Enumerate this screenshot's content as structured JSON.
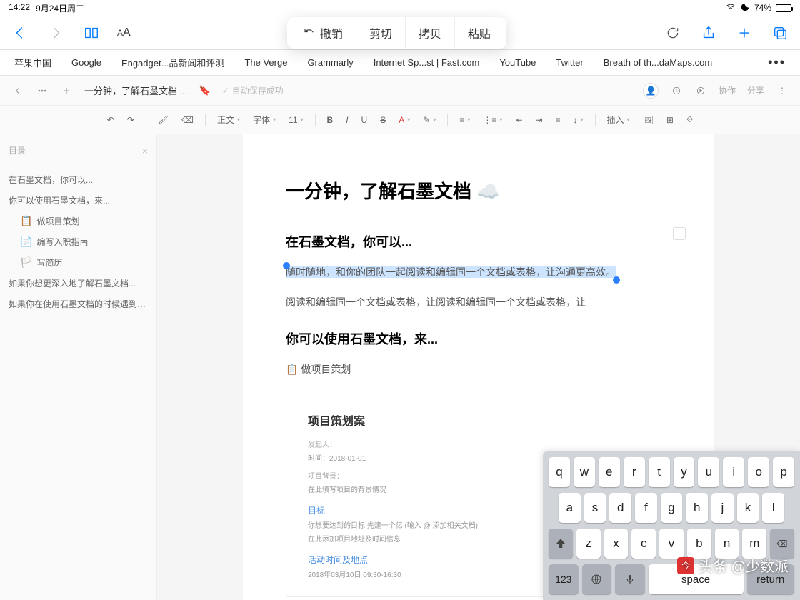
{
  "status": {
    "time": "14:22",
    "date": "9月24日周二",
    "battery": "74%"
  },
  "safari": {
    "callout": {
      "undo": "撤销",
      "cut": "剪切",
      "copy": "拷贝",
      "paste": "粘贴"
    }
  },
  "favorites": [
    "苹果中国",
    "Google",
    "Engadget...品新闻和评测",
    "The Verge",
    "Grammarly",
    "Internet Sp...st | Fast.com",
    "YouTube",
    "Twitter",
    "Breath of th...daMaps.com"
  ],
  "appHeader": {
    "title": "一分钟，了解石墨文档 ...",
    "autosave": "自动保存成功",
    "actions": {
      "coop": "协作",
      "share": "分享"
    }
  },
  "toolbar": {
    "normal": "正文",
    "font": "字体",
    "size": "11",
    "insert": "插入"
  },
  "sidebar": {
    "title": "目录",
    "items": [
      "在石墨文档，你可以...",
      "你可以使用石墨文档，来...",
      "如果你想更深入地了解石墨文档...",
      "如果你在使用石墨文档的时候遇到问题..."
    ],
    "subs": [
      {
        "emoji": "📋",
        "label": "做项目策划"
      },
      {
        "emoji": "📄",
        "label": "编写入职指南"
      },
      {
        "emoji": "🏳️",
        "label": "写简历"
      }
    ]
  },
  "doc": {
    "title": "一分钟，了解石墨文档 ☁️",
    "h2_1": "在石墨文档，你可以...",
    "selected": "随时随地，和你的团队一起阅读和编辑同一个文档或表格，让沟通更高效。",
    "p2": "阅读和编辑同一个文档或表格，让阅读和编辑同一个文档或表格，让",
    "h2_2": "你可以使用石墨文档，来...",
    "bullet_emoji": "📋",
    "bullet": "做项目策划",
    "embed": {
      "title": "项目策划案",
      "l1": "发起人：",
      "l2": "时间：2018-01-01",
      "l3": "项目背景：",
      "l4": "在此填写项目的背景情况",
      "link1": "目标",
      "l5": "你想要达到的目标 先建一个亿  (输入 @ 添加相关文档)",
      "l6": "在此添加项目地址及时间信息",
      "link2": "活动时间及地点",
      "l7": "2018年03月10日 09:30-16:30"
    }
  },
  "keyboard": {
    "r1": [
      "q",
      "w",
      "e",
      "r",
      "t",
      "y",
      "u",
      "i",
      "o",
      "p"
    ],
    "r2": [
      "a",
      "s",
      "d",
      "f",
      "g",
      "h",
      "j",
      "k",
      "l"
    ],
    "r3": [
      "z",
      "x",
      "c",
      "v",
      "b",
      "n",
      "m"
    ],
    "num": "123",
    "space": "space",
    "return": "return"
  },
  "watermark": "头条 @少数派"
}
